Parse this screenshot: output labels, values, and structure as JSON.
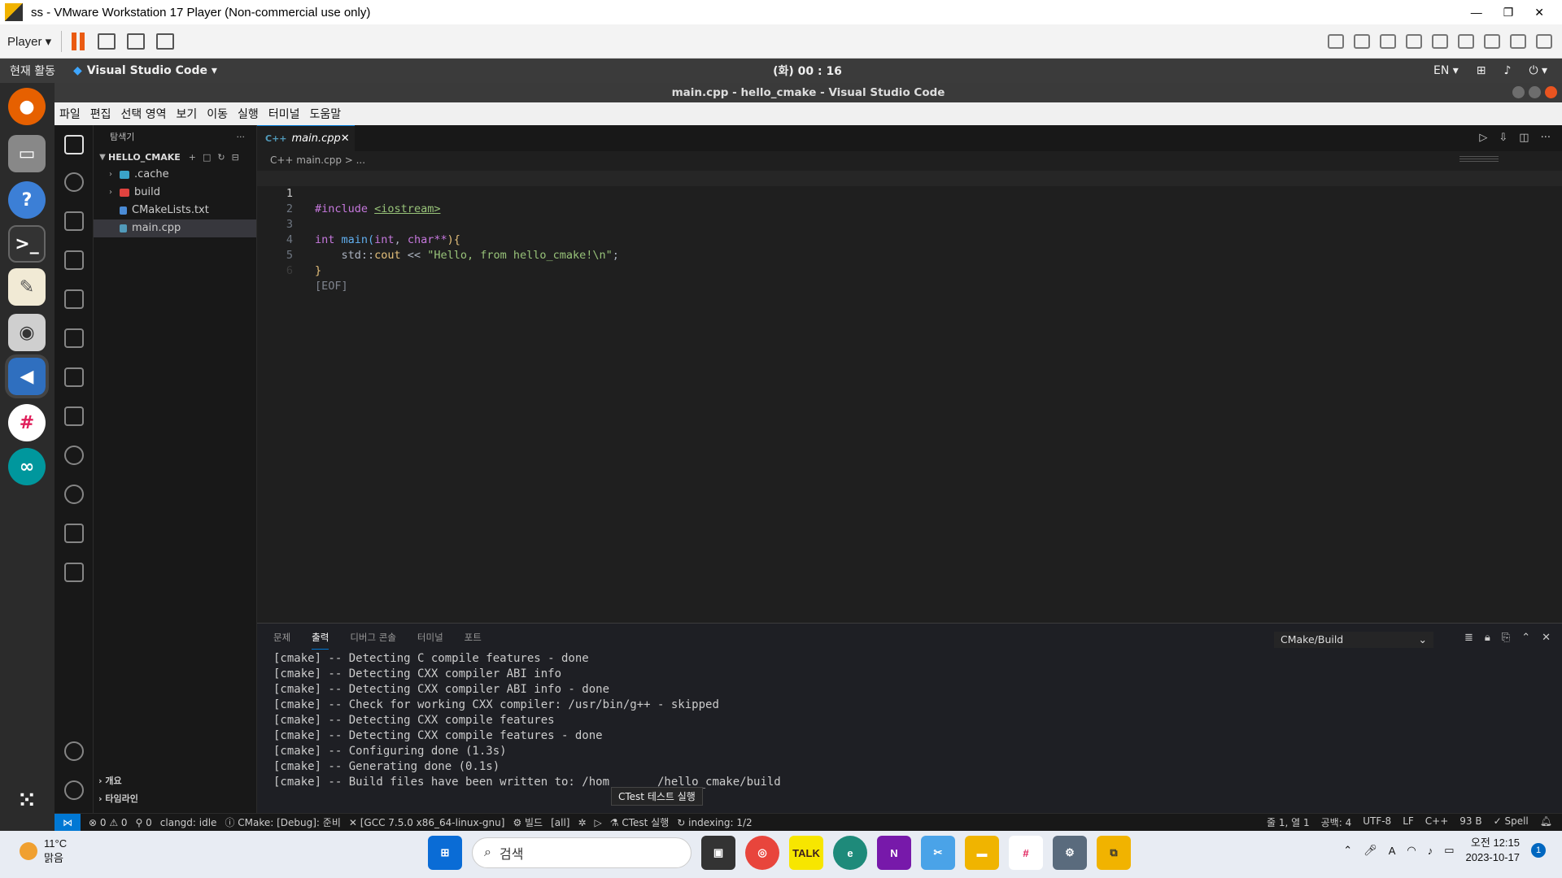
{
  "vmware": {
    "title": "ss - VMware Workstation 17 Player (Non-commercial use only)",
    "player_menu": "Player ▾",
    "win_buttons": [
      "—",
      "❐",
      "✕"
    ]
  },
  "gnome": {
    "activities": "현재 활동",
    "app_name": "Visual Studio Code ▾",
    "clock": "(화) 00 : 16",
    "lang": "EN ▾"
  },
  "vscode": {
    "window_title": "main.cpp - hello_cmake - Visual Studio Code",
    "menu": [
      "파일",
      "편집",
      "선택 영역",
      "보기",
      "이동",
      "실행",
      "터미널",
      "도움말"
    ],
    "explorer": {
      "header": "탐색기",
      "more": "···",
      "folder": "HELLO_CMAKE",
      "items": [
        {
          "label": ".cache",
          "type": "folder"
        },
        {
          "label": "build",
          "type": "folder"
        },
        {
          "label": "CMakeLists.txt",
          "type": "file"
        },
        {
          "label": "main.cpp",
          "type": "file",
          "selected": true
        }
      ],
      "outline": "개요",
      "timeline": "타임라인"
    },
    "tab": {
      "lang": "C++",
      "label": "main.cpp",
      "close": "✕"
    },
    "breadcrumb": "C++ main.cpp > ...",
    "code": {
      "line_numbers": [
        "1",
        "2",
        "3",
        "4",
        "5",
        "6"
      ],
      "l1_kw": "#include",
      "l1_inc": "<iostream>",
      "l3_a": "int",
      "l3_b": "main(",
      "l3_c": "int",
      "l3_d": ", ",
      "l3_e": "char**",
      "l3_f": "){",
      "l4_a": "    std::",
      "l4_b": "cout",
      "l4_c": " << ",
      "l4_d": "\"Hello, from hello_cmake!\\n\"",
      "l4_e": ";",
      "l5": "}",
      "l6": "[EOF]"
    },
    "panel": {
      "tabs": [
        "문제",
        "출력",
        "디버그 콘솔",
        "터미널",
        "포트"
      ],
      "active_tab": "출력",
      "output_channel": "CMake/Build",
      "output_lines": [
        "[cmake] -- Detecting C compile features - done",
        "[cmake] -- Detecting CXX compiler ABI info",
        "[cmake] -- Detecting CXX compiler ABI info - done",
        "[cmake] -- Check for working CXX compiler: /usr/bin/g++ - skipped",
        "[cmake] -- Detecting CXX compile features",
        "[cmake] -- Detecting CXX compile features - done",
        "[cmake] -- Configuring done (1.3s)",
        "[cmake] -- Generating done (0.1s)",
        "[cmake] -- Build files have been written to: /hom       /hello_cmake/build"
      ],
      "tooltip": "CTest 테스트 실행"
    },
    "status": {
      "problems": "⊗ 0 ⚠ 0",
      "ports": "⚲ 0",
      "clangd": "clangd: idle",
      "cmake": "ⓘ CMake: [Debug]: 준비",
      "kit": "✕ [GCC 7.5.0 x86_64-linux-gnu]",
      "build": "⚙ 빌드",
      "target": "[all]",
      "ctest": "⚗ CTest 실행",
      "indexing": "↻ indexing: 1/2",
      "position": "줄 1, 열 1",
      "spaces": "공백: 4",
      "encoding": "UTF-8",
      "eol": "LF",
      "language": "C++",
      "size": "93 B",
      "spell": "✓ Spell"
    }
  },
  "taskbar": {
    "temp": "11°C",
    "weather": "맑음",
    "search": "검색",
    "time": "오전 12:15",
    "date": "2023-10-17",
    "notif_count": "1"
  }
}
